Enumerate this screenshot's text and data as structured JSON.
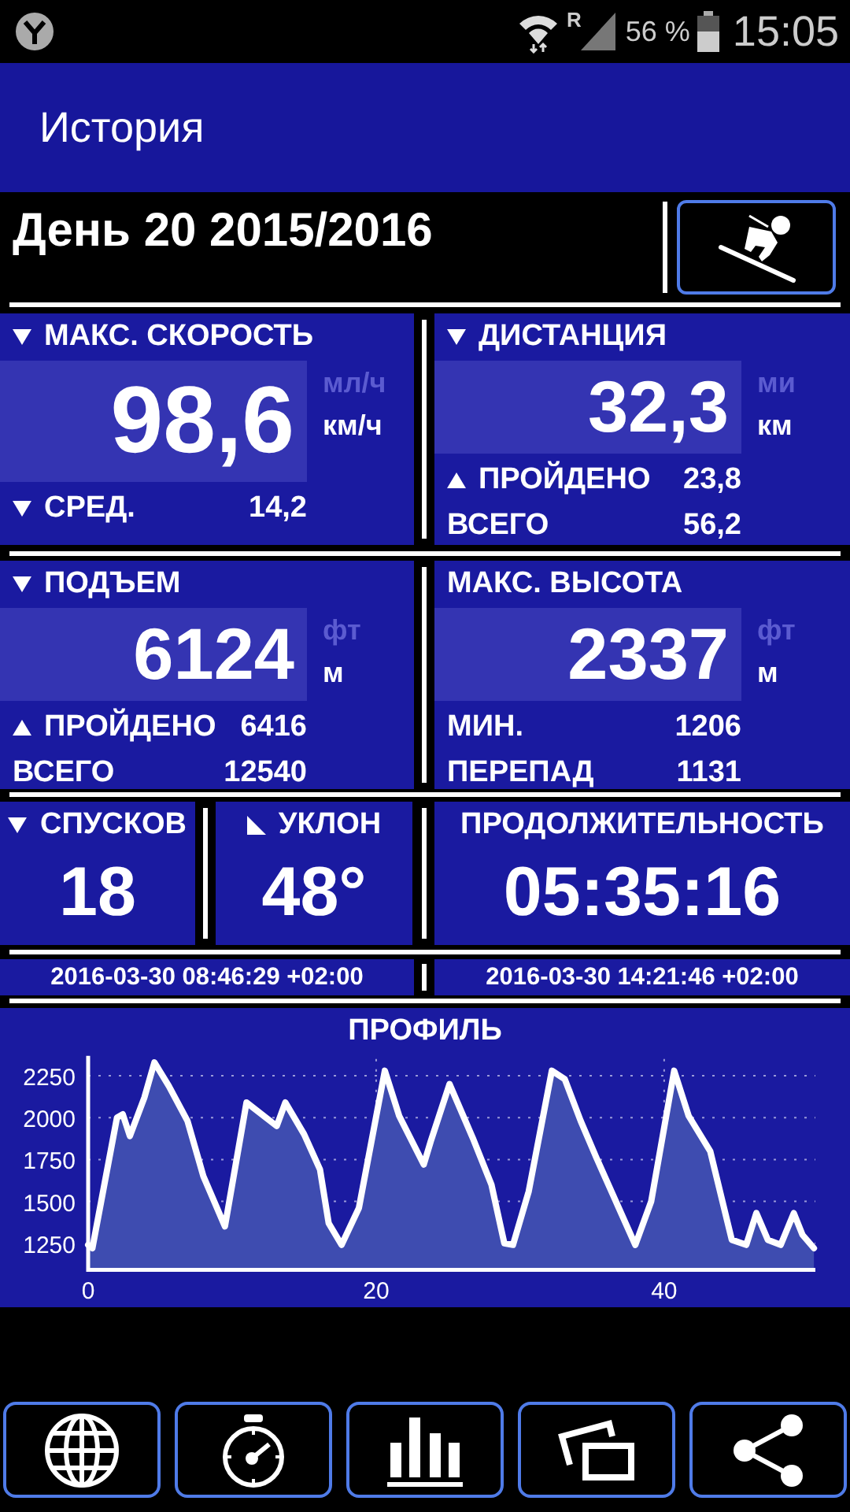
{
  "status_bar": {
    "network": "R",
    "battery": "56 %",
    "time": "15:05"
  },
  "app_bar": {
    "title": "История"
  },
  "header": {
    "title": "День 20 2015/2016",
    "mode_button": {
      "kind": "ski"
    }
  },
  "panels": [
    {
      "kind": "big",
      "marker": {
        "kind": "down"
      },
      "label": "МАКС. СКОРОСТЬ",
      "value": "98,6",
      "units": [
        {
          "label": "мл/ч",
          "selected": false
        },
        {
          "label": "км/ч",
          "selected": true
        }
      ],
      "rows": [
        {
          "marker": {
            "kind": "down"
          },
          "label": "СРЕД.",
          "value": "14,2"
        }
      ]
    },
    {
      "kind": "big",
      "marker": {
        "kind": "down"
      },
      "label": "ДИСТАНЦИЯ",
      "value": "32,3",
      "units": [
        {
          "label": "ми",
          "selected": false
        },
        {
          "label": "км",
          "selected": true
        }
      ],
      "rows": [
        {
          "marker": {
            "kind": "up"
          },
          "label": "ПРОЙДЕНО",
          "value": "23,8"
        },
        {
          "label": "ВСЕГО",
          "value": "56,2"
        }
      ]
    },
    {
      "kind": "big",
      "marker": {
        "kind": "down"
      },
      "label": "ПОДЪЕМ",
      "value": "6124",
      "units": [
        {
          "label": "фт",
          "selected": false
        },
        {
          "label": "м",
          "selected": true
        }
      ],
      "rows": [
        {
          "marker": {
            "kind": "up"
          },
          "label": "ПРОЙДЕНО",
          "value": "6416"
        },
        {
          "label": "ВСЕГО",
          "value": "12540"
        }
      ]
    },
    {
      "kind": "big",
      "label": "МАКС. ВЫСОТА",
      "value": "2337",
      "units": [
        {
          "label": "фт",
          "selected": false
        },
        {
          "label": "м",
          "selected": true
        }
      ],
      "rows": [
        {
          "label": "МИН.",
          "value": "1206"
        },
        {
          "label": "ПЕРЕПАД",
          "value": "1131"
        }
      ]
    },
    {
      "kind": "small",
      "marker": {
        "kind": "down"
      },
      "label": "СПУСКОВ",
      "value": "18"
    },
    {
      "kind": "small",
      "marker": {
        "kind": "slope"
      },
      "label": "УКЛОН",
      "value": "48°"
    },
    {
      "kind": "small",
      "label": "ПРОДОЛЖИТЕЛЬНОСТЬ",
      "value": "05:35:16"
    }
  ],
  "times": [
    "2016-03-30 08:46:29 +02:00",
    "2016-03-30 14:21:46 +02:00"
  ],
  "profile": {
    "chart_data": {
      "type": "area",
      "title": "ПРОФИЛЬ",
      "x": [
        0,
        0.3,
        2.0,
        2.4,
        2.9,
        3.9,
        4.6,
        5.6,
        6.9,
        8.0,
        9.5,
        11.0,
        13.1,
        13.7,
        15.0,
        16.1,
        16.7,
        17.6,
        18.8,
        20.6,
        21.6,
        23.3,
        23.8,
        25.1,
        26.7,
        28.0,
        28.9,
        29.5,
        30.6,
        32.2,
        33.1,
        34.2,
        35.3,
        36.8,
        38.0,
        39.1,
        40.7,
        41.7,
        43.2,
        44.7,
        45.7,
        46.4,
        47.2,
        48.1,
        49.0,
        49.6,
        50.4
      ],
      "values": [
        1240,
        1220,
        2000,
        2020,
        1890,
        2120,
        2330,
        2190,
        1980,
        1650,
        1350,
        2090,
        1950,
        2090,
        1900,
        1690,
        1370,
        1240,
        1460,
        2280,
        2010,
        1720,
        1860,
        2200,
        1880,
        1600,
        1250,
        1240,
        1560,
        2280,
        2230,
        1980,
        1760,
        1470,
        1240,
        1500,
        2280,
        2010,
        1800,
        1270,
        1240,
        1430,
        1270,
        1240,
        1430,
        1300,
        1220
      ],
      "xlim": [
        0,
        50.5
      ],
      "ylim": [
        1100,
        2350
      ],
      "xticks": [
        0,
        20,
        40
      ],
      "yticks": [
        1250,
        1500,
        1750,
        2000,
        2250
      ],
      "grid": true
    }
  },
  "toolbar": [
    {
      "kind": "globe"
    },
    {
      "kind": "stopwatch"
    },
    {
      "kind": "bars"
    },
    {
      "kind": "screens"
    },
    {
      "kind": "share"
    }
  ]
}
